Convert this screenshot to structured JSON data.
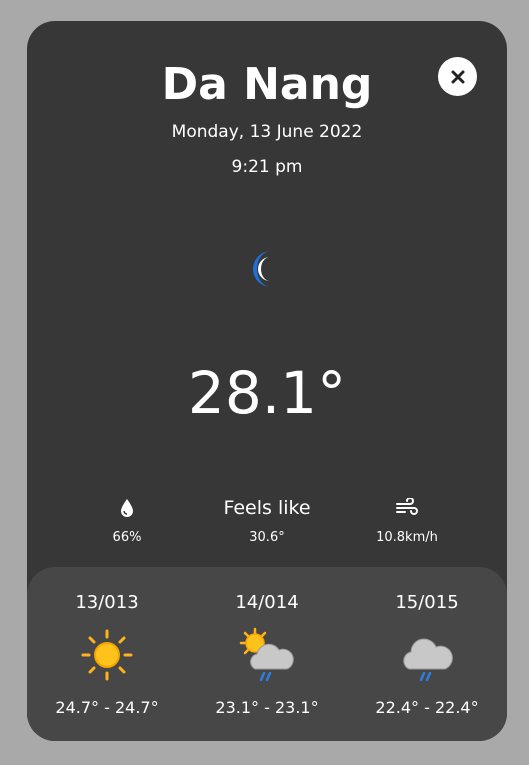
{
  "header": {
    "city": "Da Nang",
    "date": "Monday, 13 June 2022",
    "time": "9:21 pm"
  },
  "current": {
    "icon": "moon-icon",
    "temperature": "28.1°"
  },
  "metrics": {
    "humidity_value": "66%",
    "feels_like_label": "Feels like",
    "feels_like_value": "30.6°",
    "wind_value": "10.8km/h"
  },
  "forecast": [
    {
      "date": "13/013",
      "icon": "sun-icon",
      "range": "24.7° - 24.7°"
    },
    {
      "date": "14/014",
      "icon": "sun-cloud-rain-icon",
      "range": "23.1° - 23.1°"
    },
    {
      "date": "15/015",
      "icon": "cloud-rain-icon",
      "range": "22.4° - 22.4°"
    }
  ],
  "colors": {
    "page_background": "#a9a9a9",
    "card_background": "#373737",
    "forecast_background": "#474747",
    "moon_blue": "#1e6fd9",
    "sun_yellow": "#ffc21a",
    "rain_blue": "#2f7de1"
  }
}
